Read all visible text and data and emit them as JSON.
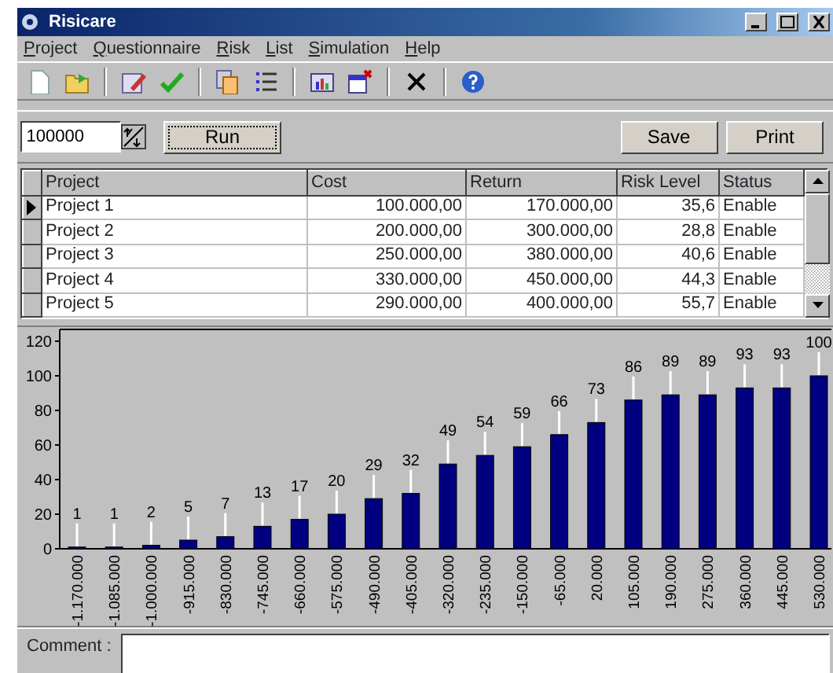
{
  "window": {
    "title": "Risicare"
  },
  "menu": [
    "Project",
    "Questionnaire",
    "Risk",
    "List",
    "Simulation",
    "Help"
  ],
  "toolbar": [
    {
      "kind": "new"
    },
    {
      "kind": "open"
    },
    {
      "kind": "sep"
    },
    {
      "kind": "edit"
    },
    {
      "kind": "check"
    },
    {
      "kind": "sep"
    },
    {
      "kind": "copy"
    },
    {
      "kind": "list"
    },
    {
      "kind": "sep"
    },
    {
      "kind": "chart"
    },
    {
      "kind": "closewin"
    },
    {
      "kind": "sep"
    },
    {
      "kind": "delete"
    },
    {
      "kind": "sep"
    },
    {
      "kind": "help"
    }
  ],
  "controls": {
    "amount": "100000",
    "run": "Run",
    "save": "Save",
    "print": "Print"
  },
  "table": {
    "columns": [
      {
        "label": "Project",
        "kind": "text"
      },
      {
        "label": "Cost",
        "kind": "number"
      },
      {
        "label": "Return",
        "kind": "number"
      },
      {
        "label": "Risk Level",
        "kind": "number"
      },
      {
        "label": "Status",
        "kind": "text"
      }
    ],
    "rows": [
      {
        "selected": true,
        "cells": [
          "Project 1",
          "100.000,00",
          "170.000,00",
          "35,6",
          "Enable"
        ]
      },
      {
        "selected": false,
        "cells": [
          "Project 2",
          "200.000,00",
          "300.000,00",
          "28,8",
          "Enable"
        ]
      },
      {
        "selected": false,
        "cells": [
          "Project 3",
          "250.000,00",
          "380.000,00",
          "40,6",
          "Enable"
        ]
      },
      {
        "selected": false,
        "cells": [
          "Project 4",
          "330.000,00",
          "450.000,00",
          "44,3",
          "Enable"
        ]
      },
      {
        "selected": false,
        "cells": [
          "Project 5",
          "290.000,00",
          "400.000,00",
          "55,7",
          "Enable"
        ]
      }
    ]
  },
  "chart": {
    "chart_data": {
      "type": "bar",
      "categories": [
        "-1.170.000",
        "-1.085.000",
        "-1.000.000",
        "-915.000",
        "-830.000",
        "-745.000",
        "-660.000",
        "-575.000",
        "-490.000",
        "-405.000",
        "-320.000",
        "-235.000",
        "-150.000",
        "-65.000",
        "20.000",
        "105.000",
        "190.000",
        "275.000",
        "360.000",
        "445.000",
        "530.000"
      ],
      "series": [
        {
          "color": "#000080",
          "values": [
            1,
            1,
            2,
            5,
            7,
            13,
            17,
            20,
            29,
            32,
            49,
            54,
            59,
            66,
            73,
            86,
            89,
            89,
            93,
            93,
            100
          ]
        }
      ],
      "ylim": [
        0,
        120
      ],
      "yticks": [
        0,
        20,
        40,
        60,
        80,
        100,
        120
      ],
      "data_labels": true
    }
  },
  "comment": {
    "label": "Comment :"
  }
}
